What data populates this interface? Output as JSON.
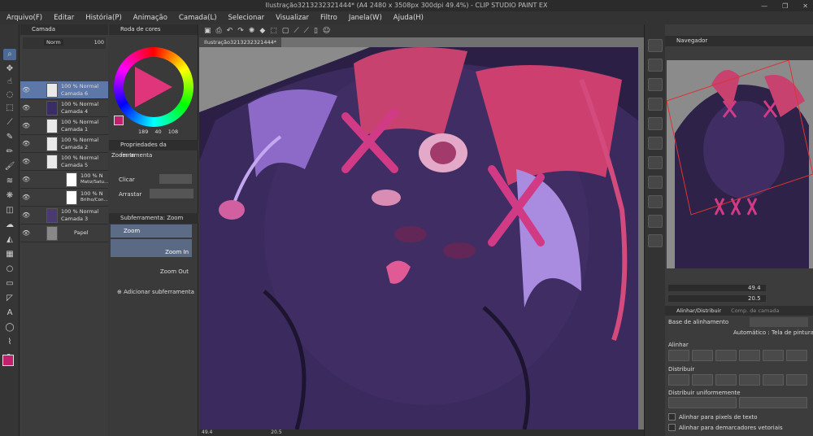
{
  "window": {
    "title": "Ilustração3213232321444* (A4 2480 x 3508px 300dpi 49.4%) - CLIP STUDIO PAINT EX",
    "controls": [
      "—",
      "❐",
      "✕"
    ]
  },
  "menu": [
    "Arquivo(F)",
    "Editar",
    "História(P)",
    "Animação",
    "Camada(L)",
    "Selecionar",
    "Visualizar",
    "Filtro",
    "Janela(W)",
    "Ajuda(H)"
  ],
  "layers_panel": {
    "title": "Camada",
    "blend_mode": "Norm",
    "opacity": "100",
    "layers": [
      {
        "mode": "100 % Normal",
        "name": "Camada 6",
        "selected": true
      },
      {
        "mode": "100 % Normal",
        "name": "Camada 4",
        "selected": false
      },
      {
        "mode": "100 % Normal",
        "name": "Camada 1",
        "selected": false
      },
      {
        "mode": "100 % Normal",
        "name": "Camada 2",
        "selected": false
      },
      {
        "mode": "100 % Normal",
        "name": "Camada 5",
        "selected": false
      },
      {
        "mode": "100 % N",
        "name": "Matiz/Satu...",
        "selected": false
      },
      {
        "mode": "100 % N",
        "name": "Brilho/Con...",
        "selected": false
      },
      {
        "mode": "100 % Normal",
        "name": "Camada 3",
        "selected": false
      },
      {
        "mode": "",
        "name": "Papel",
        "selected": false
      }
    ]
  },
  "color_panel": {
    "title": "Roda de cores",
    "values": [
      "189",
      "40",
      "108"
    ],
    "main_color": "#c21f6c"
  },
  "tool_props": {
    "title": "Propriedades da ferramenta",
    "tool": "Zoom In",
    "rows": [
      {
        "label": "Clicar"
      },
      {
        "label": "Arrastar"
      }
    ]
  },
  "subtool": {
    "title": "Subferramenta: Zoom",
    "items": [
      "Zoom",
      "Zoom In",
      "Zoom Out"
    ],
    "add_label": "Adicionar subferramenta"
  },
  "canvas": {
    "doc_tab": "Ilustração3213232321444*",
    "zoom": "49.4",
    "angle": "20.5"
  },
  "navigator": {
    "title": "Navegador",
    "zoom": "49.4",
    "angle": "20.5"
  },
  "align_panel": {
    "tabs": [
      "Alinhar/Distribuir",
      "Comp. de camada"
    ],
    "base_label": "Base de alinhamento",
    "auto_label": "Automático : Tela de pintura",
    "section_align": "Alinhar",
    "section_distribute": "Distribuir",
    "section_distribute_even": "Distribuir uniformemente",
    "check_text": "Alinhar para pixels de texto",
    "check_vector": "Alinhar para demarcadores vetoriais"
  }
}
